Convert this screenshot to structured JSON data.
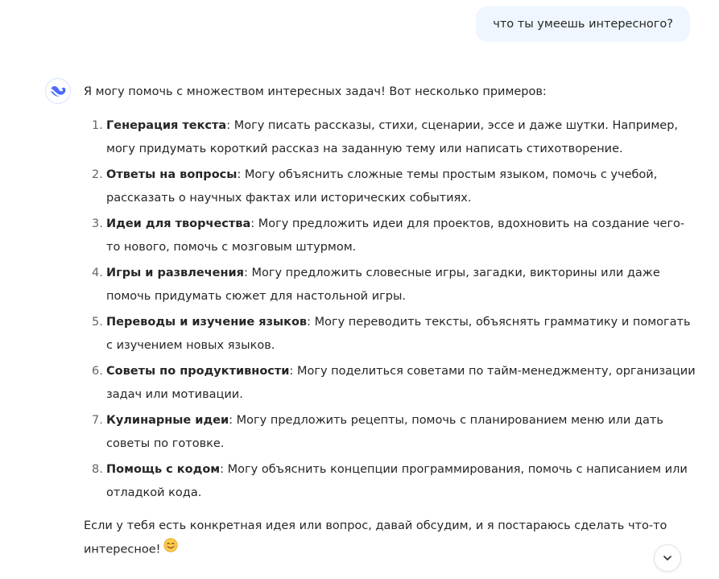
{
  "user_message": "что ты умеешь интересного?",
  "assistant": {
    "avatar_icon": "deepseek-whale-logo",
    "intro": "Я могу помочь с множеством интересных задач! Вот несколько примеров:",
    "items": [
      {
        "num": "1.",
        "title": "Генерация текста",
        "text": ": Могу писать рассказы, стихи, сценарии, эссе и даже шутки. Например, могу придумать короткий рассказ на заданную тему или написать стихотворение."
      },
      {
        "num": "2.",
        "title": "Ответы на вопросы",
        "text": ": Могу объяснить сложные темы простым языком, помочь с учебой, рассказать о научных фактах или исторических событиях."
      },
      {
        "num": "3.",
        "title": "Идеи для творчества",
        "text": ": Могу предложить идеи для проектов, вдохновить на создание чего-то нового, помочь с мозговым штурмом."
      },
      {
        "num": "4.",
        "title": "Игры и развлечения",
        "text": ": Могу предложить словесные игры, загадки, викторины или даже помочь придумать сюжет для настольной игры."
      },
      {
        "num": "5.",
        "title": "Переводы и изучение языков",
        "text": ": Могу переводить тексты, объяснять грамматику и помогать с изучением новых языков."
      },
      {
        "num": "6.",
        "title": "Советы по продуктивности",
        "text": ": Могу поделиться советами по тайм-менеджменту, организации задач или мотивации."
      },
      {
        "num": "7.",
        "title": "Кулинарные идеи",
        "text": ": Могу предложить рецепты, помочь с планированием меню или дать советы по готовке."
      },
      {
        "num": "8.",
        "title": "Помощь с кодом",
        "text": ": Могу объяснить концепции программирования, помочь с написанием или отладкой кода."
      }
    ],
    "outro": "Если у тебя есть конкретная идея или вопрос, давай обсудим, и я постараюсь сделать что-то интересное!",
    "emoji_icon": "smiling-face-emoji"
  },
  "scroll_button_icon": "chevron-down-icon",
  "colors": {
    "user_bubble_bg": "#eff6ff",
    "brand_blue": "#4d6bfe",
    "text": "#262626"
  }
}
